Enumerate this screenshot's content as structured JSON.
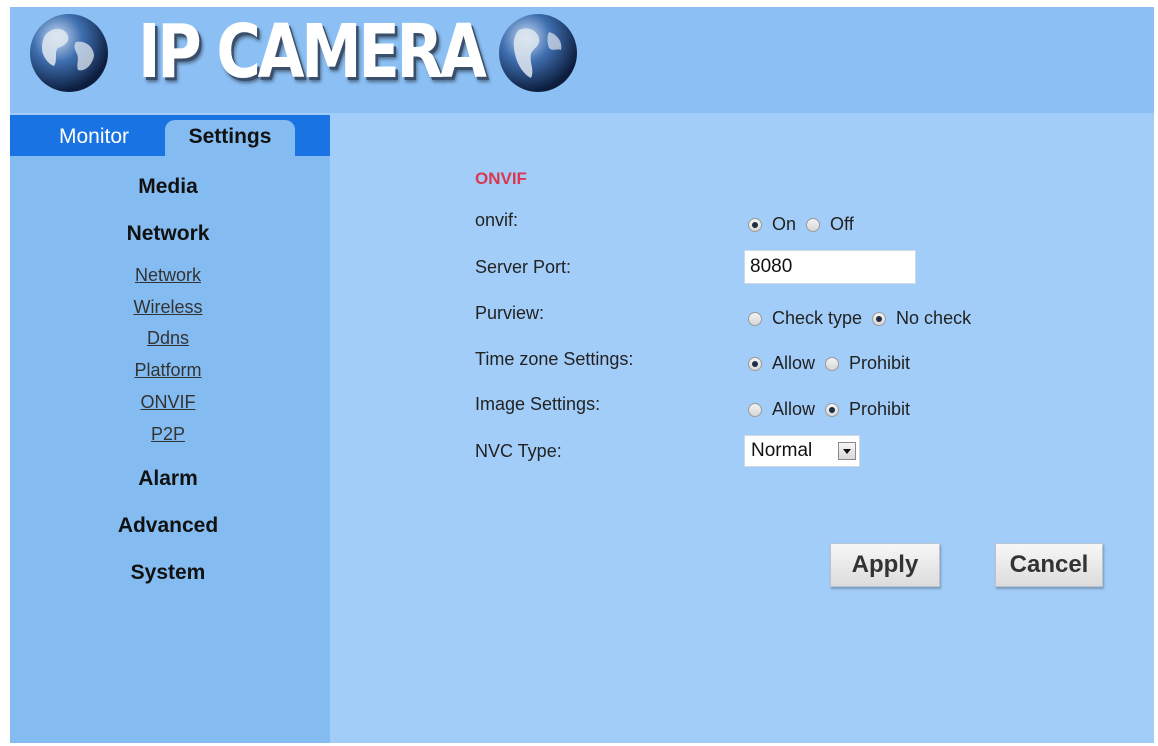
{
  "header": {
    "title": "IP CAMERA"
  },
  "tabs": {
    "monitor": "Monitor",
    "settings": "Settings"
  },
  "sidebar": {
    "sections": {
      "media": "Media",
      "network": "Network",
      "alarm": "Alarm",
      "advanced": "Advanced",
      "system": "System"
    },
    "network_links": [
      "Network",
      "Wireless",
      "Ddns",
      "Platform",
      "ONVIF",
      "P2P"
    ]
  },
  "form": {
    "title": "ONVIF",
    "onvif": {
      "label": "onvif:",
      "options": [
        "On",
        "Off"
      ],
      "selected": "On"
    },
    "server_port": {
      "label": "Server Port:",
      "value": "8080"
    },
    "purview": {
      "label": "Purview:",
      "options": [
        "Check type",
        "No check"
      ],
      "selected": "No check"
    },
    "time_zone": {
      "label": "Time zone Settings:",
      "options": [
        "Allow",
        "Prohibit"
      ],
      "selected": "Allow"
    },
    "image_settings": {
      "label": "Image Settings:",
      "options": [
        "Allow",
        "Prohibit"
      ],
      "selected": "Prohibit"
    },
    "nvc_type": {
      "label": "NVC Type:",
      "value": "Normal"
    }
  },
  "buttons": {
    "apply": "Apply",
    "cancel": "Cancel"
  },
  "colors": {
    "header_bg": "#8cc0f5",
    "content_bg": "#a2cdf8",
    "sidebar_bg": "#84bcf2",
    "tabbar_bg": "#1a73e3",
    "section_title": "#d9384f"
  },
  "icons": {
    "logo_left": "globe-icon",
    "logo_right": "globe-icon"
  }
}
